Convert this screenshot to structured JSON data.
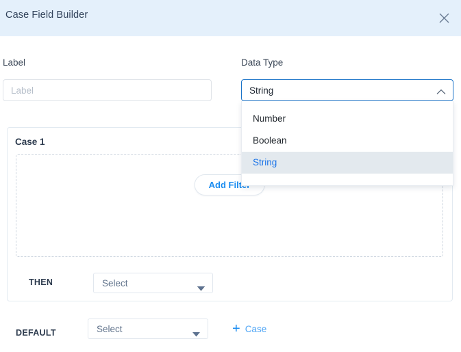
{
  "header": {
    "title": "Case Field Builder",
    "close_icon": "close-icon"
  },
  "form": {
    "label_field": {
      "label": "Label",
      "placeholder": "Label",
      "value": ""
    },
    "data_type_field": {
      "label": "Data Type",
      "selected": "String",
      "caret_icon": "chevron-up-icon",
      "expanded": true,
      "options": [
        {
          "label": "Number",
          "selected": false
        },
        {
          "label": "Boolean",
          "selected": false
        },
        {
          "label": "String",
          "selected": true
        }
      ]
    }
  },
  "case_panel": {
    "title": "Case 1",
    "add_filter_label": "Add Filter",
    "then": {
      "label": "THEN",
      "select_placeholder": "Select",
      "caret_icon": "chevron-down-icon"
    }
  },
  "default_row": {
    "label": "DEFAULT",
    "select_placeholder": "Select",
    "caret_icon": "chevron-down-icon",
    "add_case_plus": "+",
    "add_case_label": "Case"
  },
  "colors": {
    "header_bg": "#e4f0fb",
    "accent_blue": "#1a73e8",
    "link_blue": "#1a8cf0",
    "focus_border": "#1a73c8",
    "text_dark": "#2d3b4e",
    "text_muted": "#63758d",
    "highlight_bg": "#e3e9ee"
  }
}
